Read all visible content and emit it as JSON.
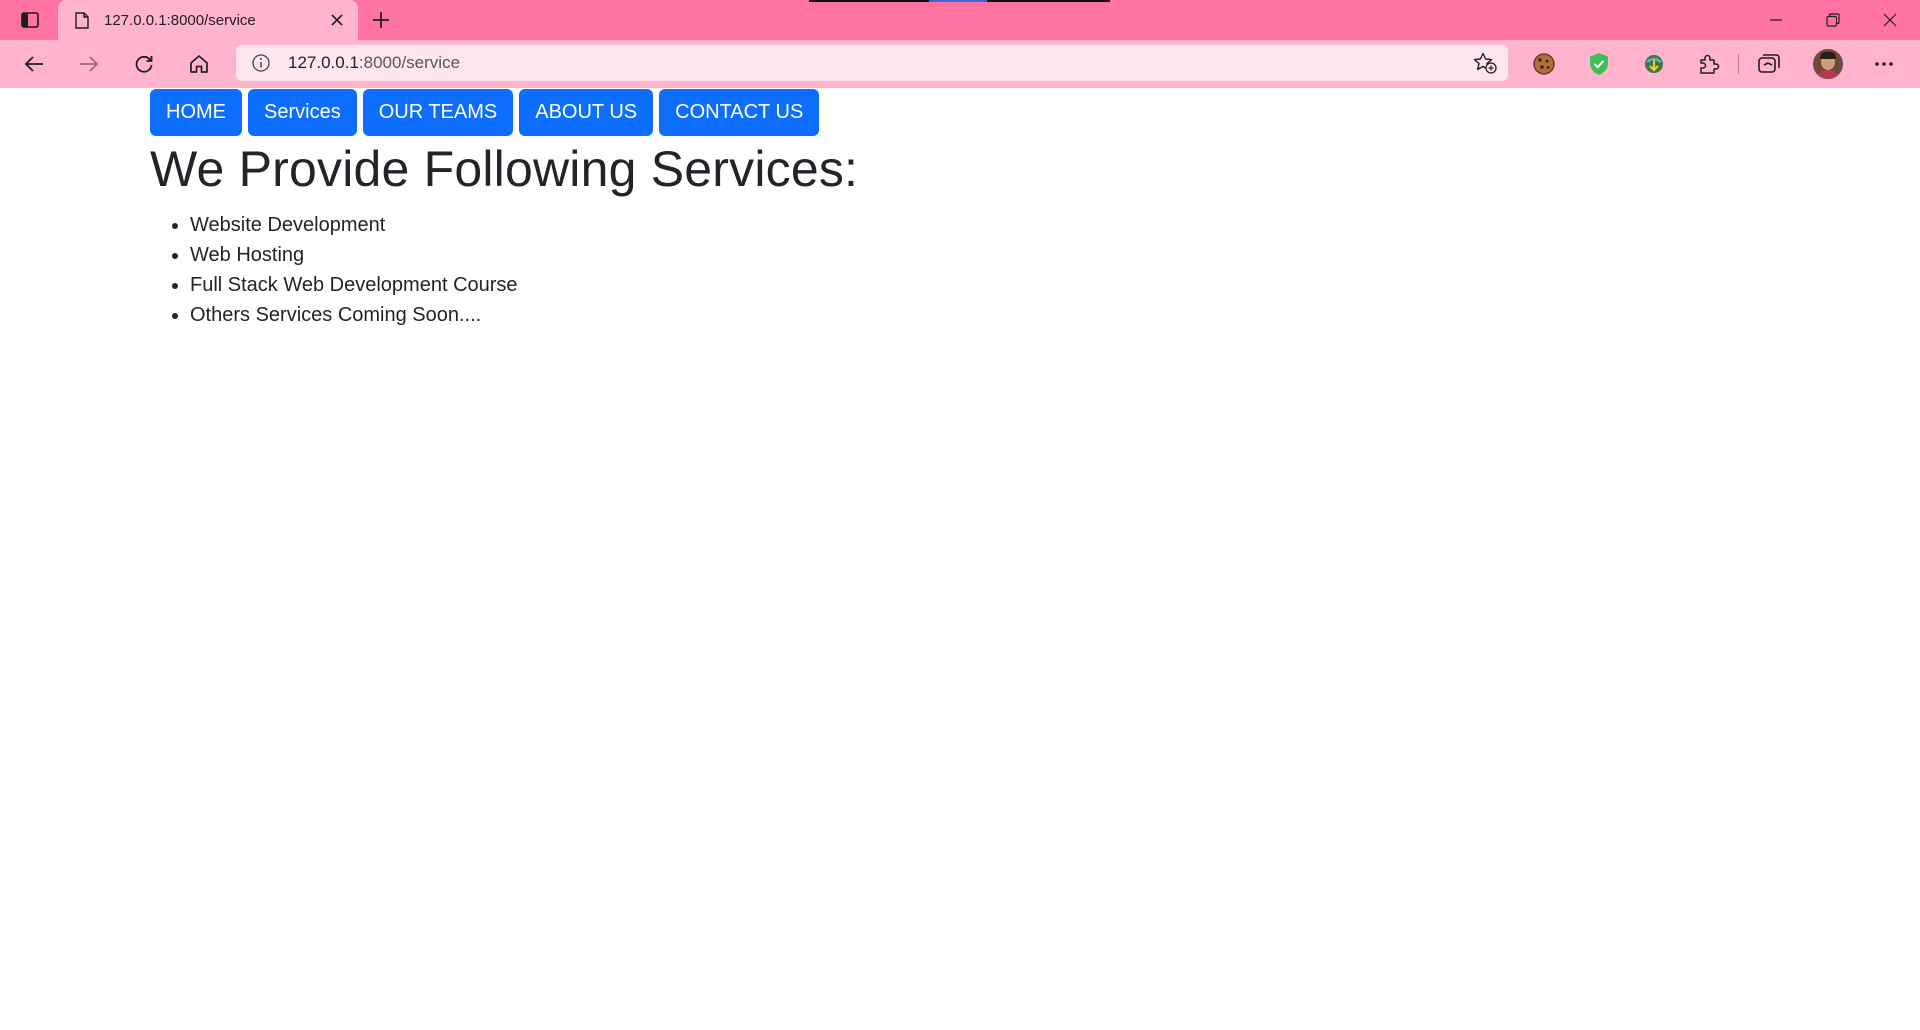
{
  "browser": {
    "tab": {
      "title": "127.0.0.1:8000/service"
    },
    "address": {
      "host": "127.0.0.1",
      "path": ":8000/service"
    }
  },
  "nav": {
    "items": [
      {
        "label": "HOME"
      },
      {
        "label": "Services"
      },
      {
        "label": "OUR TEAMS"
      },
      {
        "label": "ABOUT US"
      },
      {
        "label": "CONTACT US"
      }
    ]
  },
  "main": {
    "heading": "We Provide Following Services:",
    "services": [
      "Website Development",
      "Web Hosting",
      "Full Stack Web Development Course",
      "Others Services Coming Soon...."
    ]
  },
  "colors": {
    "tabstrip": "#ff73a0",
    "toolbar": "#ffb3cc",
    "nav_button": "#0d6efd",
    "text": "#212529"
  }
}
